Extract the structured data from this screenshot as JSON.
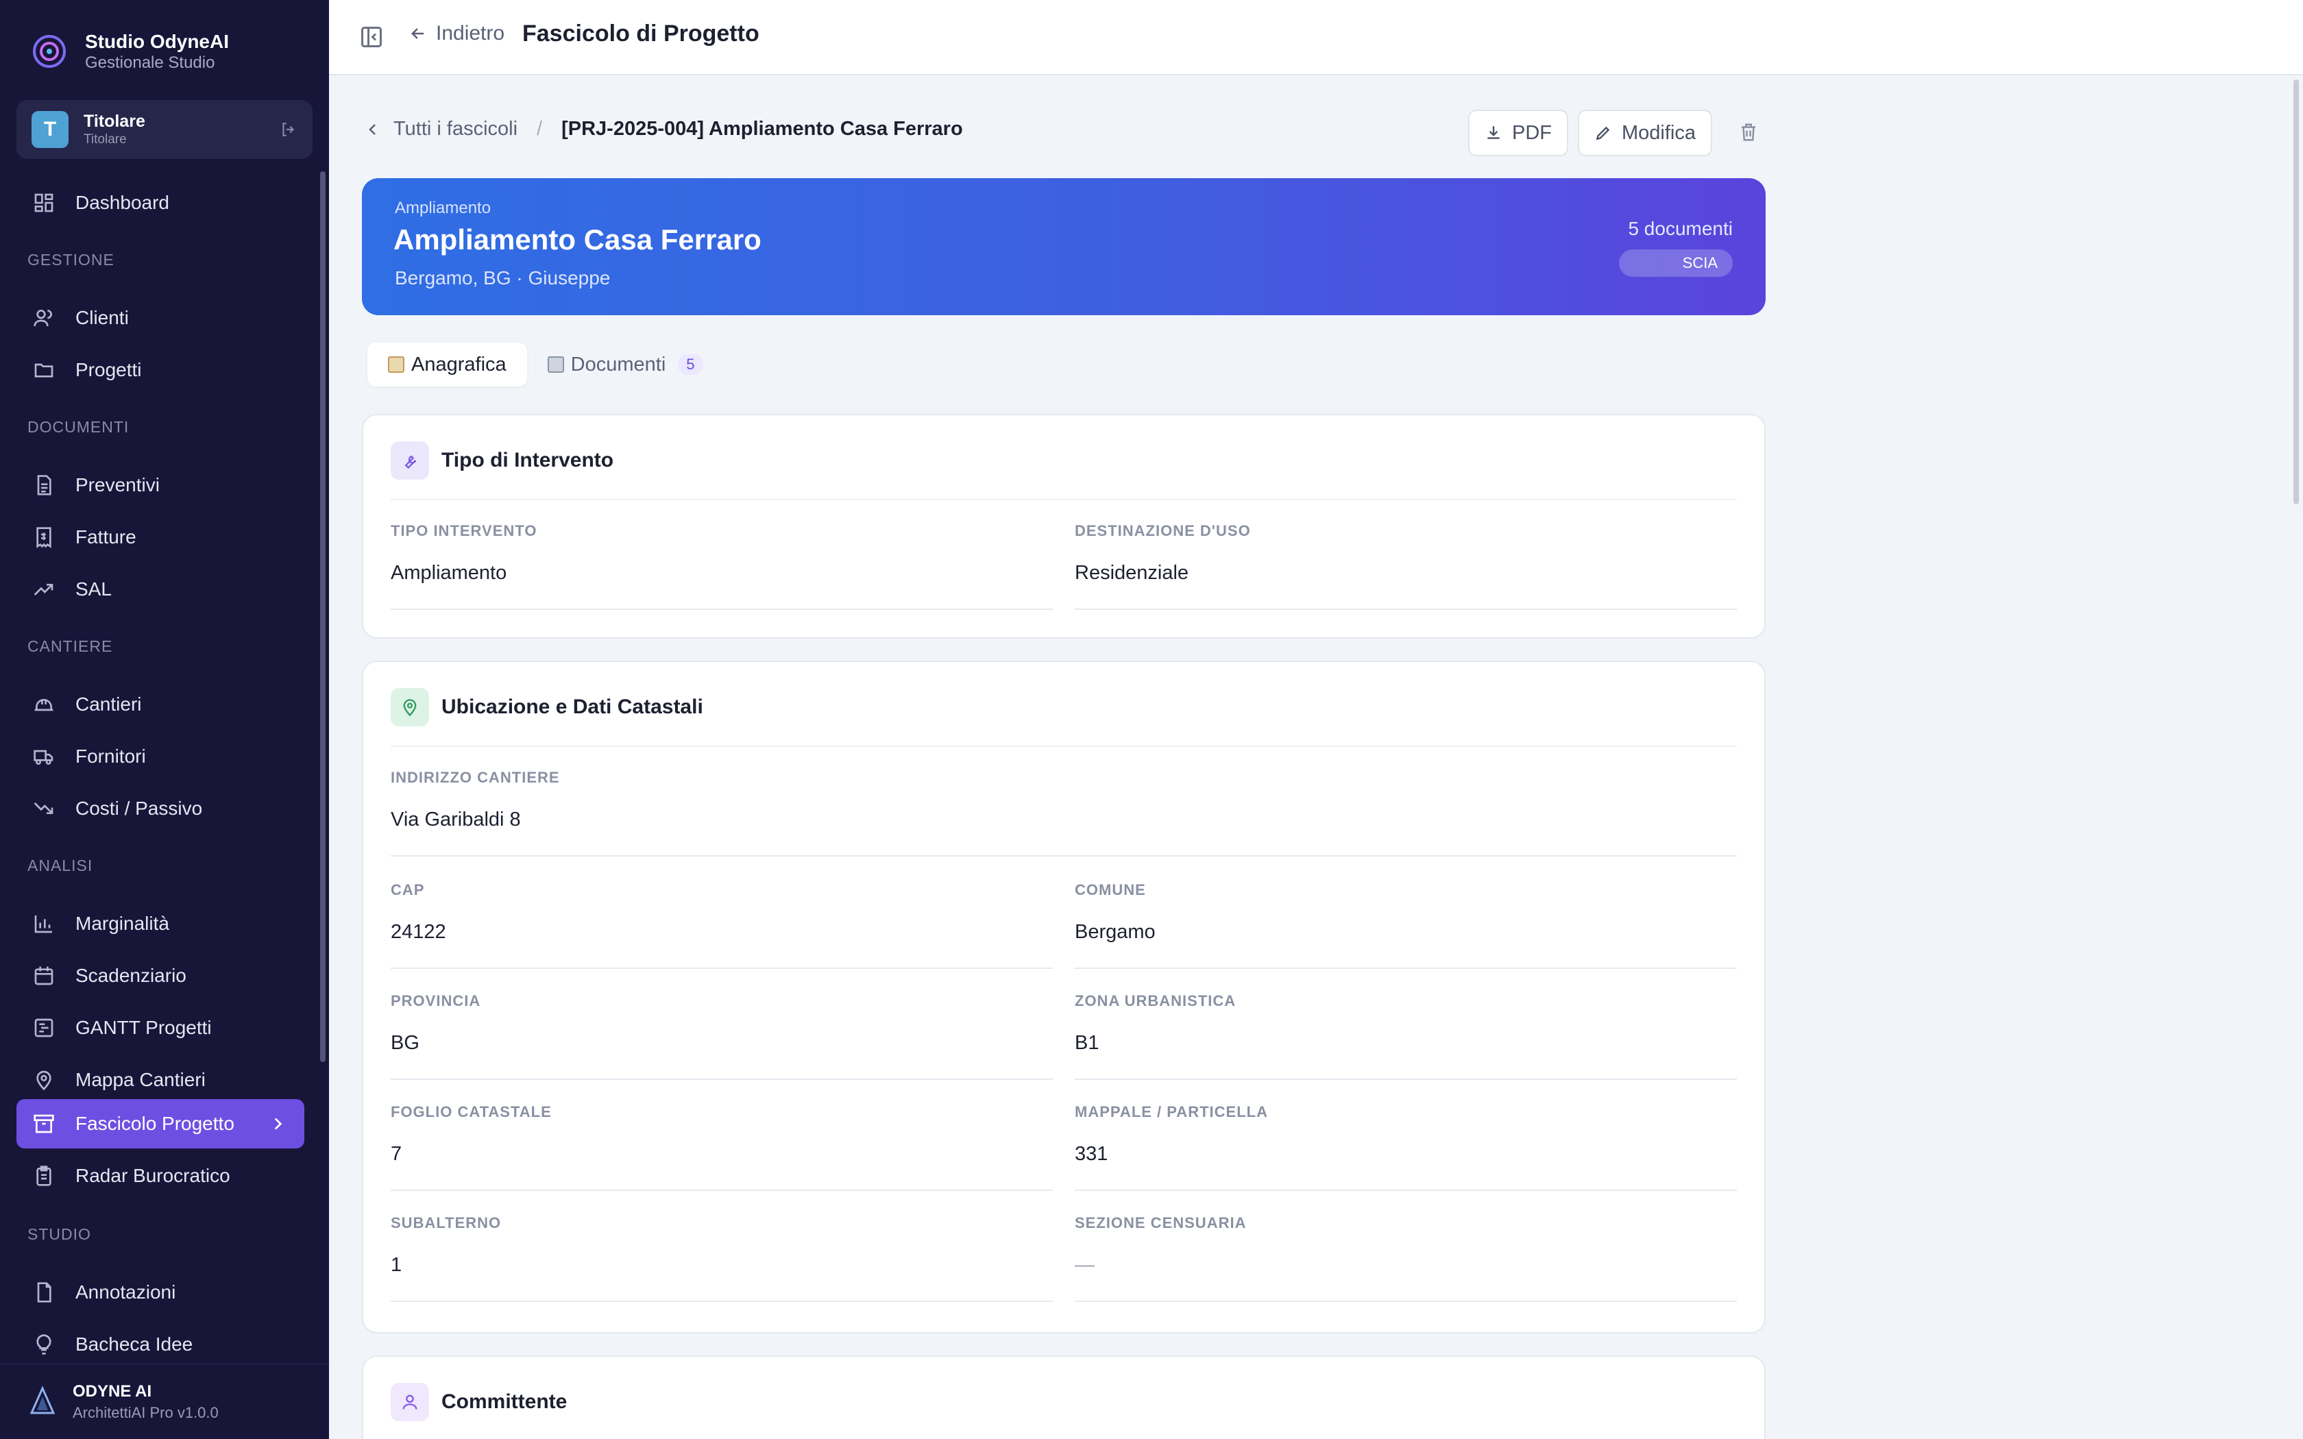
{
  "sidebar": {
    "brand_title": "Studio OdyneAI",
    "brand_sub": "Gestionale Studio",
    "user": {
      "initial": "T",
      "name": "Titolare",
      "role": "Titolare"
    },
    "sections": {
      "gestione": "GESTIONE",
      "documenti": "DOCUMENTI",
      "cantiere": "CANTIERE",
      "analisi": "ANALISI",
      "studio": "STUDIO"
    },
    "items": {
      "dashboard": "Dashboard",
      "clienti": "Clienti",
      "progetti": "Progetti",
      "preventivi": "Preventivi",
      "fatture": "Fatture",
      "sal": "SAL",
      "cantieri": "Cantieri",
      "fornitori": "Fornitori",
      "costi": "Costi / Passivo",
      "marginalita": "Marginalità",
      "scadenziario": "Scadenziario",
      "gantt": "GANTT Progetti",
      "mappa": "Mappa Cantieri",
      "fascicolo": "Fascicolo Progetto",
      "radar": "Radar Burocratico",
      "annotazioni": "Annotazioni",
      "bacheca": "Bacheca Idee"
    },
    "footer_title": "ODYNE AI",
    "footer_sub": "ArchitettiAI Pro v1.0.0"
  },
  "topbar": {
    "back_label": "Indietro",
    "title": "Fascicolo di Progetto"
  },
  "breadcrumb": {
    "parent": "Tutti i fascicoli",
    "sep": "/",
    "current": "[PRJ-2025-004] Ampliamento Casa Ferraro"
  },
  "actions": {
    "pdf": "PDF",
    "edit": "Modifica"
  },
  "hero": {
    "type": "Ampliamento",
    "title": "Ampliamento Casa Ferraro",
    "location": "Bergamo, BG · Giuseppe",
    "docs": "5 documenti",
    "badge": "SCIA"
  },
  "tabs": {
    "anagrafica": "Anagrafica",
    "documenti": "Documenti",
    "documenti_count": "5"
  },
  "intervento": {
    "title": "Tipo di Intervento",
    "tipo_label": "TIPO INTERVENTO",
    "tipo_value": "Ampliamento",
    "dest_label": "DESTINAZIONE D'USO",
    "dest_value": "Residenziale"
  },
  "ubicazione": {
    "title": "Ubicazione e Dati Catastali",
    "indirizzo_label": "INDIRIZZO CANTIERE",
    "indirizzo_value": "Via Garibaldi 8",
    "cap_label": "CAP",
    "cap_value": "24122",
    "comune_label": "COMUNE",
    "comune_value": "Bergamo",
    "provincia_label": "PROVINCIA",
    "provincia_value": "BG",
    "zona_label": "ZONA URBANISTICA",
    "zona_value": "B1",
    "foglio_label": "FOGLIO CATASTALE",
    "foglio_value": "7",
    "mappale_label": "MAPPALE / PARTICELLA",
    "mappale_value": "331",
    "sub_label": "SUBALTERNO",
    "sub_value": "1",
    "sezione_label": "SEZIONE CENSUARIA",
    "sezione_value": "—"
  },
  "committente": {
    "title": "Committente"
  },
  "colors": {
    "sidebar_bg": "#171639",
    "active": "#6e4fe2",
    "hero_start": "#2f6ee4",
    "hero_end": "#5a44dc"
  }
}
